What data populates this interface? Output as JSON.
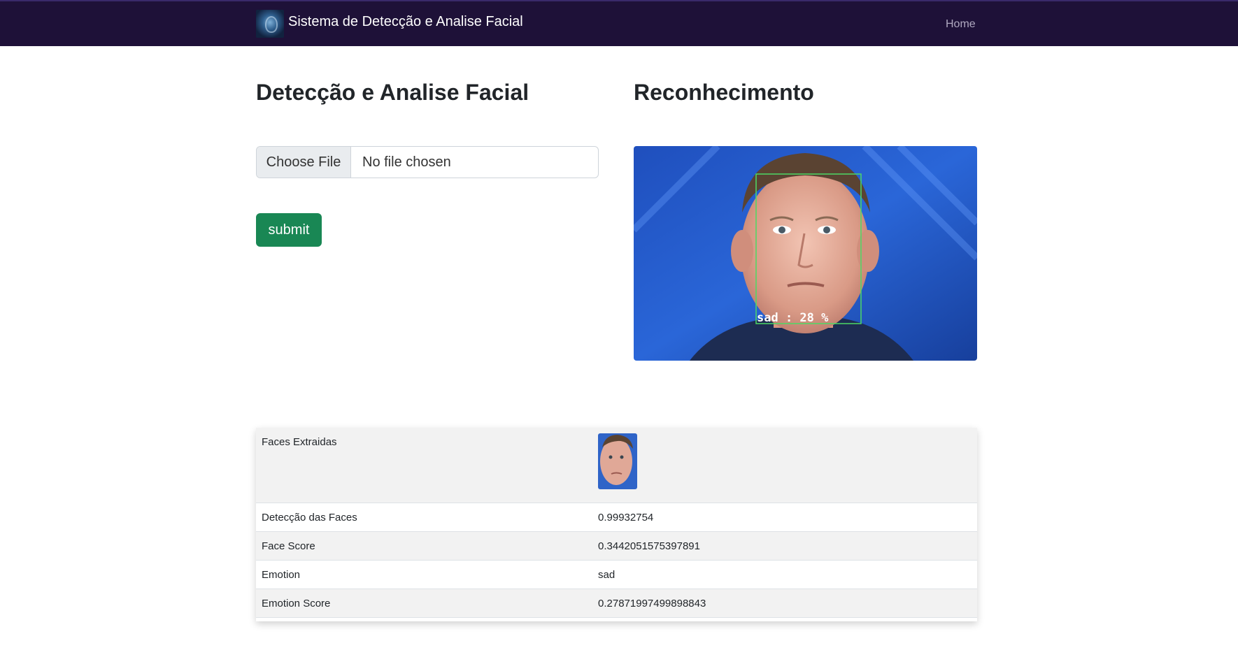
{
  "navbar": {
    "brand_title": "Sistema de Detecção e Analise Facial",
    "home_link": "Home",
    "logo_icon": "face-scan-logo"
  },
  "upload_section": {
    "heading": "Detecção e Analise Facial",
    "choose_file_label": "Choose File",
    "file_status": "No file chosen",
    "submit_label": "submit"
  },
  "recognition_section": {
    "heading": "Reconhecimento",
    "overlay_label": "sad : 28 %"
  },
  "results": {
    "rows": [
      {
        "label": "Faces Extraidas",
        "value": ""
      },
      {
        "label": "Detecção das Faces",
        "value": "0.99932754"
      },
      {
        "label": "Face Score",
        "value": "0.3442051575397891"
      },
      {
        "label": "Emotion",
        "value": "sad"
      },
      {
        "label": "Emotion Score",
        "value": "0.27871997499898843"
      }
    ]
  },
  "colors": {
    "navbar_bg": "#1e1138",
    "submit_bg": "#198754",
    "detection_box": "#4cd964",
    "image_bg": "#1e4fb8"
  }
}
